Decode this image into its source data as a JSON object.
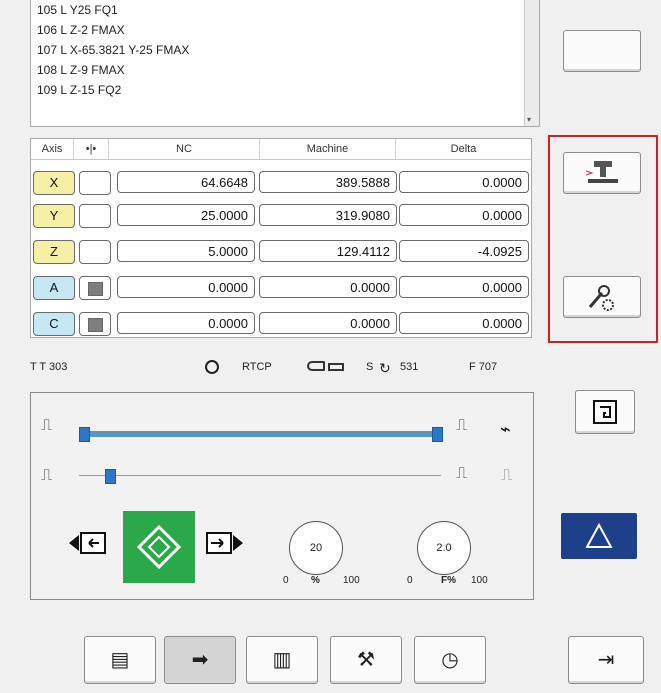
{
  "program": {
    "lines": [
      "105 L Y25 FQ1",
      "106 L Z-2 FMAX",
      "107 L X-65.3821 Y-25 FMAX",
      "108 L Z-9 FMAX",
      "109 L Z-15 FQ2"
    ],
    "scroll_arrow": "▾"
  },
  "table": {
    "headers": {
      "axis": "Axis",
      "flag": "•|•",
      "nc": "NC",
      "machine": "Machine",
      "delta": "Delta"
    },
    "rows": [
      {
        "axis": "X",
        "nc": "64.6648",
        "machine": "389.5888",
        "delta": "0.0000",
        "color": "#f6f0a6",
        "checked": false
      },
      {
        "axis": "Y",
        "nc": "25.0000",
        "machine": "319.9080",
        "delta": "0.0000",
        "color": "#f6f0a6",
        "checked": false
      },
      {
        "axis": "Z",
        "nc": "5.0000",
        "machine": "129.4112",
        "delta": "-4.0925",
        "color": "#f6f0a6",
        "checked": false
      },
      {
        "axis": "A",
        "nc": "0.0000",
        "machine": "0.0000",
        "delta": "0.0000",
        "color": "#c6e7f4",
        "checked": true
      },
      {
        "axis": "C",
        "nc": "0.0000",
        "machine": "0.0000",
        "delta": "0.0000",
        "color": "#c6e7f4",
        "checked": true
      }
    ]
  },
  "status": {
    "tool": "T T 303",
    "rtcp": "RTCP",
    "spindle": "S",
    "spindle_val": "531",
    "feed": "F 707"
  },
  "overrides": {
    "spindle_value": "20",
    "spindle_min": "0",
    "spindle_max": "100",
    "spindle_label": "%",
    "feed_value": "2.0",
    "feed_min": "0",
    "feed_max": "100",
    "feed_label": "F%"
  },
  "colors": {
    "highlight": "#d32020",
    "start": "#2aa84a",
    "triangle": "#1e3f8a"
  }
}
